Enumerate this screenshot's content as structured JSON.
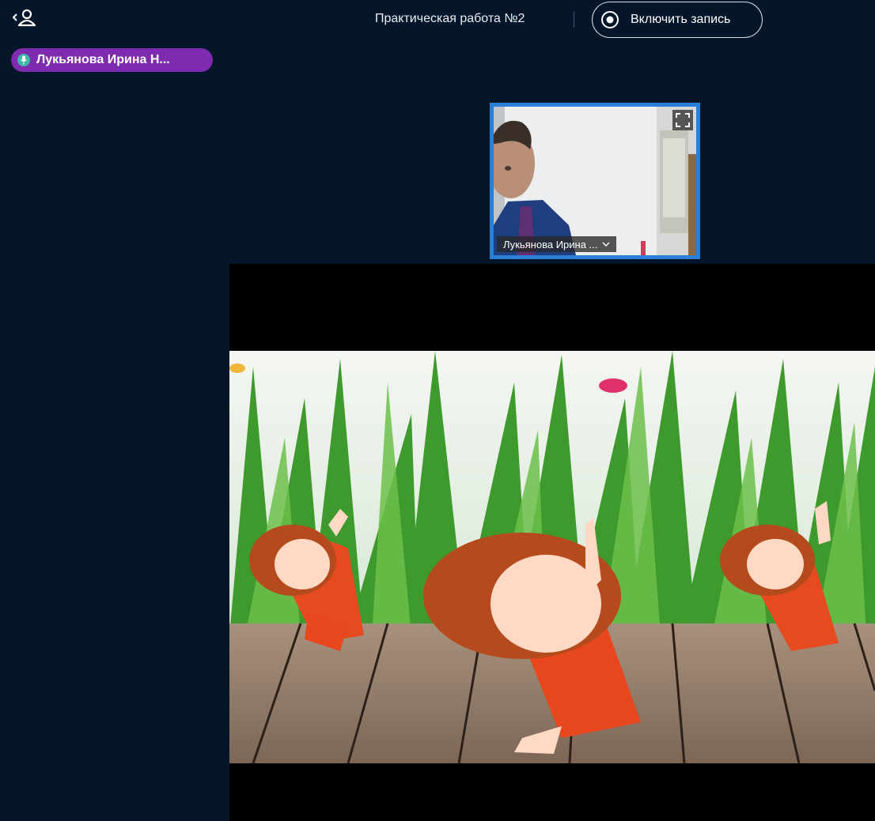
{
  "topbar": {
    "meeting_title": "Практическая работа №2",
    "record_label": "Включить запись"
  },
  "talking": {
    "name": "Лукьянова Ирина Н..."
  },
  "webcam": {
    "name_tag": "Лукьянова Ирина ..."
  },
  "colors": {
    "background": "#06162a",
    "talking_badge": "#7e2bb0",
    "mic": "#3fb8a8",
    "tile_border": "#2c7fd6"
  },
  "icons": {
    "users": "user-list-toggle-icon",
    "record": "record-icon",
    "mic": "microphone-icon",
    "fullscreen": "fullscreen-icon",
    "dropdown": "chevron-down-icon"
  }
}
